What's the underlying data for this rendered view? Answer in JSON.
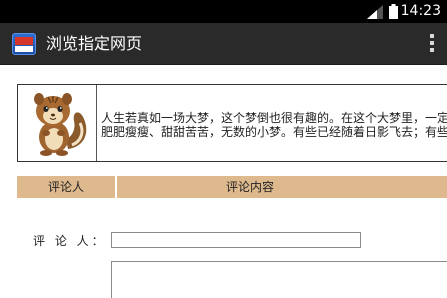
{
  "status_bar": {
    "time": "14:23"
  },
  "action_bar": {
    "title": "浏览指定网页"
  },
  "article": {
    "line1": "人生若真如一场大梦，这个梦倒也很有趣的。在这个大梦里，一定还有",
    "line2": "肥肥瘦瘦、甜甜苦苦，无数的小梦。有些已经随着日影飞去；有些还"
  },
  "comments_table": {
    "col_commenter": "评论人",
    "col_content": "评论内容"
  },
  "form": {
    "commenter_label": "评 论 人：",
    "commenter_value": "",
    "content_value": ""
  },
  "colors": {
    "header_bg": "#deb98e",
    "action_bar": "#2a2a2a",
    "status_bar": "#000000"
  }
}
